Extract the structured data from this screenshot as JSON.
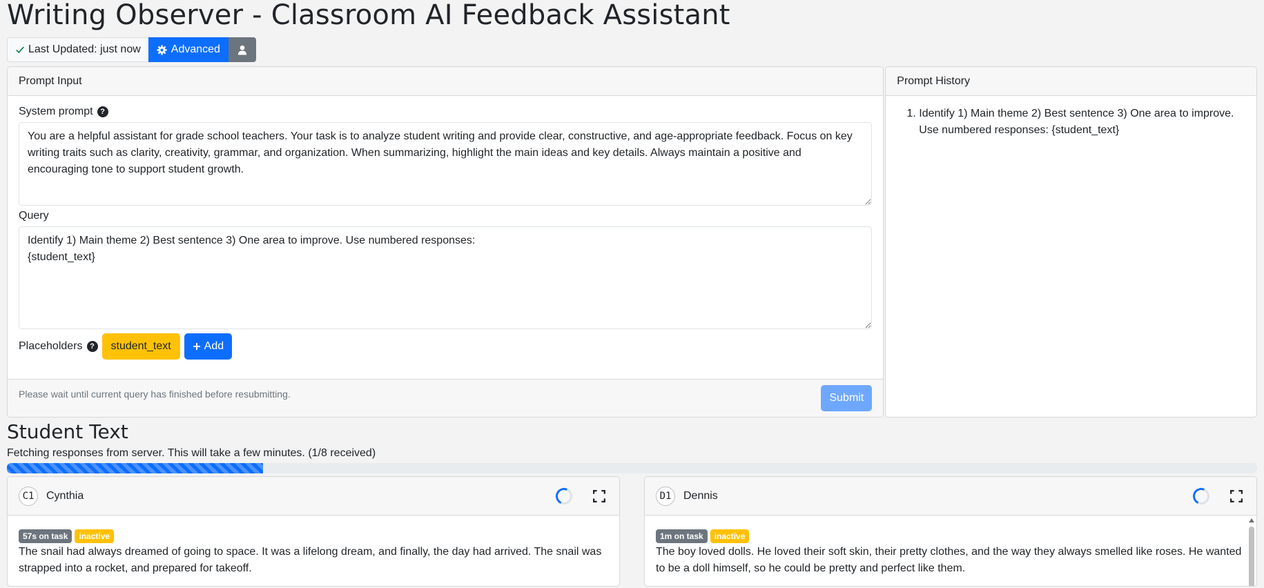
{
  "app": {
    "title": "Writing Observer - Classroom AI Feedback Assistant"
  },
  "toolbar": {
    "status_label": "Last Updated: just now",
    "advanced_label": "Advanced"
  },
  "prompt_input": {
    "header": "Prompt Input",
    "system_prompt_label": "System prompt",
    "system_prompt_value": "You are a helpful assistant for grade school teachers. Your task is to analyze student writing and provide clear, constructive, and age-appropriate feedback. Focus on key writing traits such as clarity, creativity, grammar, and organization. When summarizing, highlight the main ideas and key details. Always maintain a positive and encouraging tone to support student growth.",
    "query_label": "Query",
    "query_value": "Identify 1) Main theme 2) Best sentence 3) One area to improve. Use numbered responses:\n{student_text}",
    "placeholders_label": "Placeholders",
    "placeholders": [
      "student_text"
    ],
    "add_label": "Add",
    "footer_note": "Please wait until current query has finished before resubmitting.",
    "submit_label": "Submit"
  },
  "prompt_history": {
    "header": "Prompt History",
    "items": [
      "Identify 1) Main theme 2) Best sentence 3) One area to improve. Use numbered responses: {student_text}"
    ]
  },
  "student_text": {
    "title": "Student Text",
    "fetch_message": "Fetching responses from server. This will take a few minutes. (1/8 received)",
    "progress_fraction": 0.205,
    "students": [
      {
        "initials": "C1",
        "name": "Cynthia",
        "time_badge": "57s on task",
        "status_badge": "inactive",
        "text": "The snail had always dreamed of going to space. It was a lifelong dream, and finally, the day had arrived. The snail was strapped into a rocket, and prepared for takeoff."
      },
      {
        "initials": "D1",
        "name": "Dennis",
        "time_badge": "1m on task",
        "status_badge": "inactive",
        "text": "The boy loved dolls. He loved their soft skin, their pretty clothes, and the way they always smelled like roses. He wanted to be a doll himself, so he could be pretty and perfect like them."
      }
    ]
  },
  "colors": {
    "primary": "#0d6efd",
    "warning": "#ffc107",
    "secondary": "#6c757d",
    "submit_disabled": "#6ea8fe"
  },
  "icons": [
    "check-icon",
    "gear-icon",
    "user-icon",
    "help-icon",
    "plus-icon",
    "spinner-icon",
    "expand-icon"
  ]
}
